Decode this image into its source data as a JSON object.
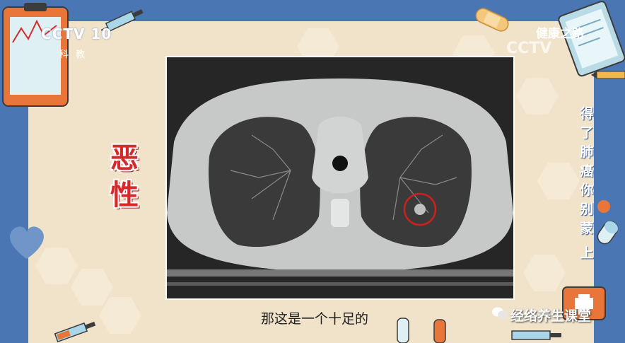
{
  "channel": {
    "logo": "CCTV 10",
    "sub": "科教"
  },
  "show": {
    "title": "健康之路",
    "watermark": "CCTV"
  },
  "side_label": [
    "恶",
    "性"
  ],
  "vertical_caption": [
    "得",
    "了",
    "肺",
    "癌",
    "你",
    "别",
    "蒙",
    "上"
  ],
  "subtitle": "那这是一个十足的",
  "wechat": {
    "name": "经络养生课堂",
    "icon": "wechat-icon"
  },
  "colors": {
    "frame": "#4a77b3",
    "background": "#f1e3c9",
    "accent_red": "#d6292b",
    "marker_circle": "#cc2020"
  }
}
